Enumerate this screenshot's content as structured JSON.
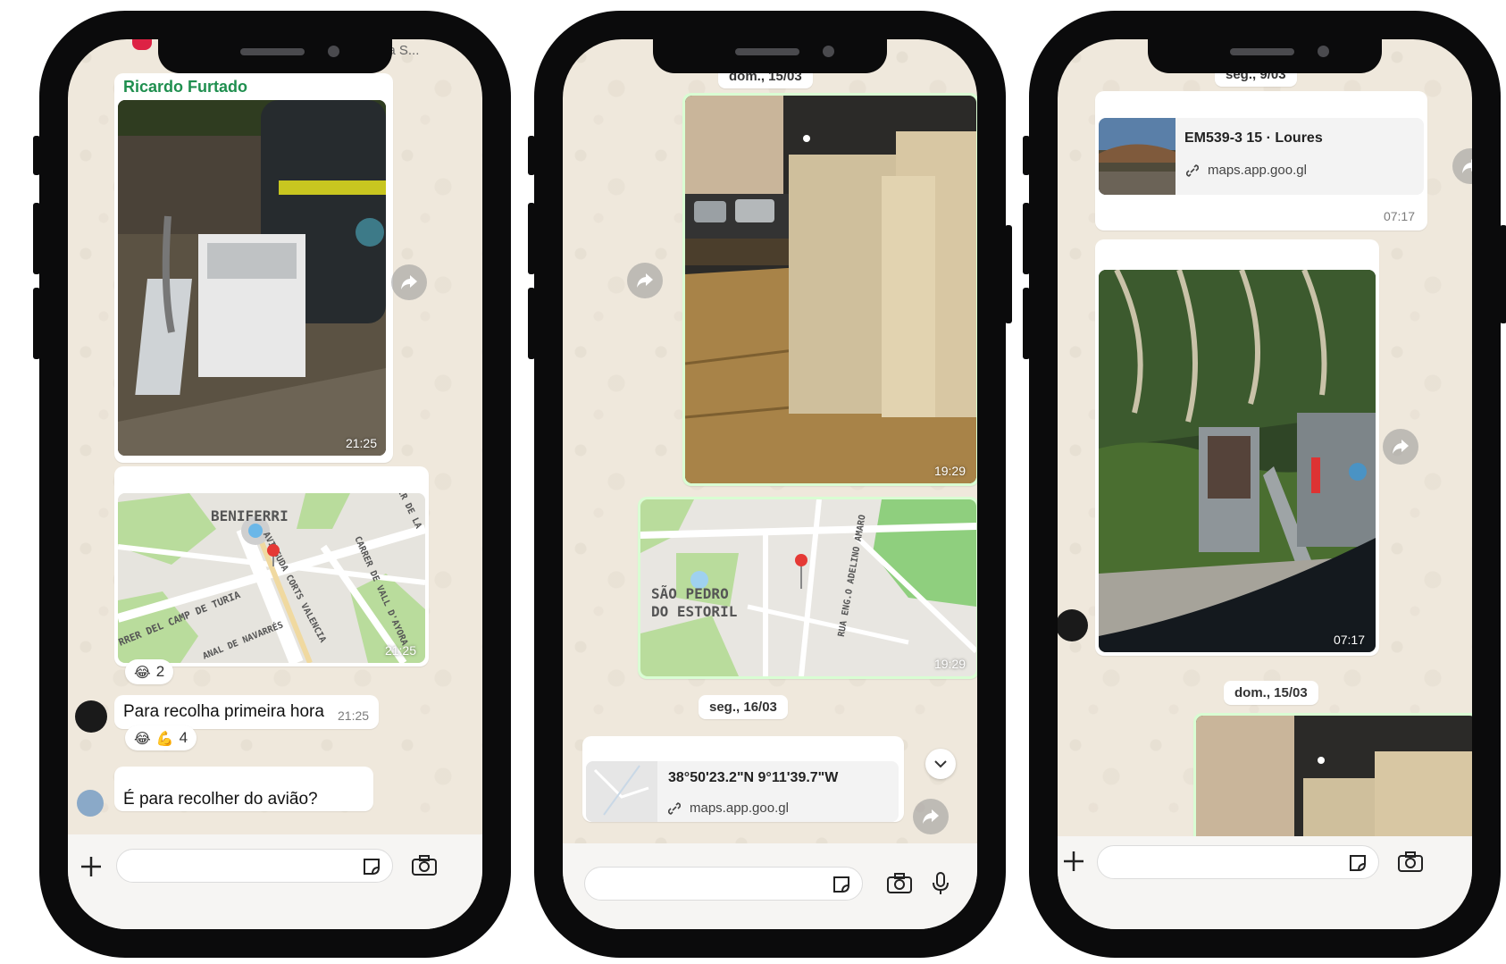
{
  "phones": [
    {
      "header_name": "Ana S...",
      "sender": "Ricardo Furtado",
      "photo_time": "21:25",
      "map_time": "21:25",
      "map_labels": [
        "BENIFERRI",
        "RRER DEL CAMP DE TURIA",
        "AVINGUDA CORTS VALENCIA",
        "CARRER DE VALL D'AYORA",
        "ANAL DE NAVARRÉS",
        "ER DE LA"
      ],
      "reaction1_count": "2",
      "text_message": "Para recolha primeira hora",
      "text_time": "21:25",
      "reaction2_count": "4",
      "preview_text": "É para recolher do avião?"
    },
    {
      "date_top": "dom., 15/03",
      "photo_time": "19:29",
      "map_time": "19:29",
      "map_labels": [
        "SÃO PEDRO",
        "DO ESTORIL",
        "RUA ENG.O ADELINO AMARO"
      ],
      "date_chip": "seg., 16/03",
      "coords": "38°50'23.2\"N 9°11'39.7\"W",
      "link_url": "maps.app.goo.gl"
    },
    {
      "date_top": "seg., 9/03",
      "link_title": "EM539-3 15 · Loures",
      "link_url": "maps.app.goo.gl",
      "link_time": "07:17",
      "photo_time": "07:17",
      "date_chip": "dom., 15/03"
    }
  ],
  "colors": {
    "sender_name": "#1f8f4f",
    "outgoing_bubble": "#d9fdd3",
    "chat_background": "#efe8dc"
  }
}
